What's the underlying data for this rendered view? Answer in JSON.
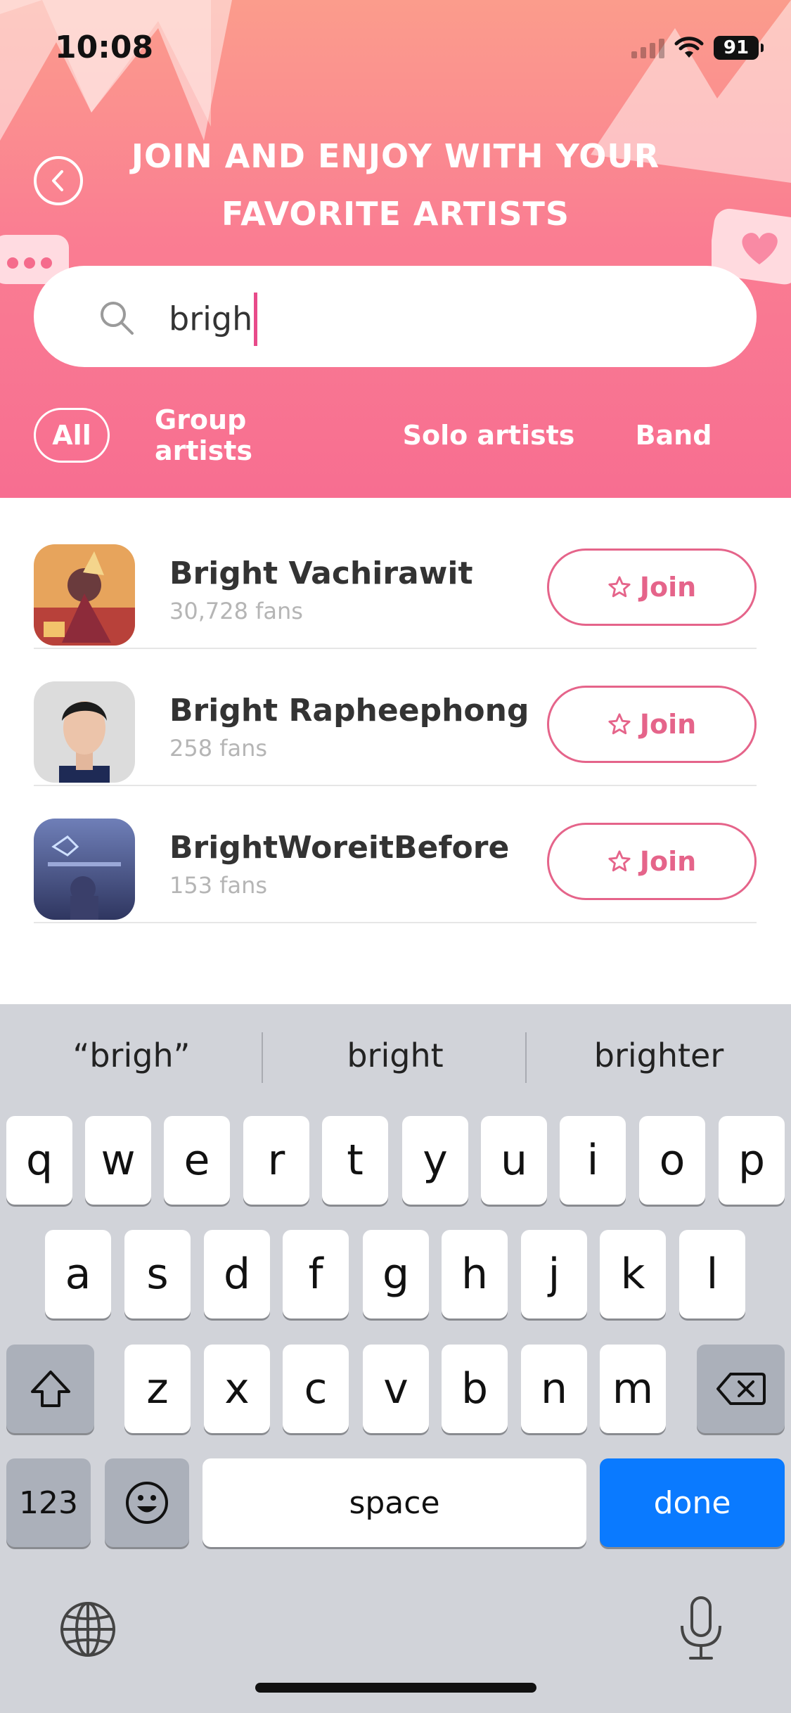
{
  "status_bar": {
    "time": "10:08",
    "battery": "91"
  },
  "header": {
    "title_line1": "JOIN AND ENJOY WITH YOUR",
    "title_line2": "FAVORITE ARTISTS",
    "back_icon": "chevron-left-icon"
  },
  "search": {
    "value": "brigh",
    "icon": "search-icon"
  },
  "filters": [
    {
      "label": "All",
      "active": true
    },
    {
      "label": "Group artists",
      "active": false
    },
    {
      "label": "Solo artists",
      "active": false
    },
    {
      "label": "Band",
      "active": false
    }
  ],
  "results": [
    {
      "name": "Bright Vachirawit",
      "fans": "30,728 fans",
      "join_label": "Join"
    },
    {
      "name": "Bright Rapheephong",
      "fans": "258 fans",
      "join_label": "Join"
    },
    {
      "name": "BrightWoreitBefore",
      "fans": "153 fans",
      "join_label": "Join"
    }
  ],
  "keyboard": {
    "suggestions": [
      "“brigh”",
      "bright",
      "brighter"
    ],
    "row1": [
      "q",
      "w",
      "e",
      "r",
      "t",
      "y",
      "u",
      "i",
      "o",
      "p"
    ],
    "row2": [
      "a",
      "s",
      "d",
      "f",
      "g",
      "h",
      "j",
      "k",
      "l"
    ],
    "row3": [
      "z",
      "x",
      "c",
      "v",
      "b",
      "n",
      "m"
    ],
    "numbers_label": "123",
    "space_label": "space",
    "done_label": "done"
  },
  "colors": {
    "accent": "#e5648a",
    "header_top": "#fb9c8c",
    "header_bottom": "#f76e91",
    "done_blue": "#0a7aff"
  }
}
